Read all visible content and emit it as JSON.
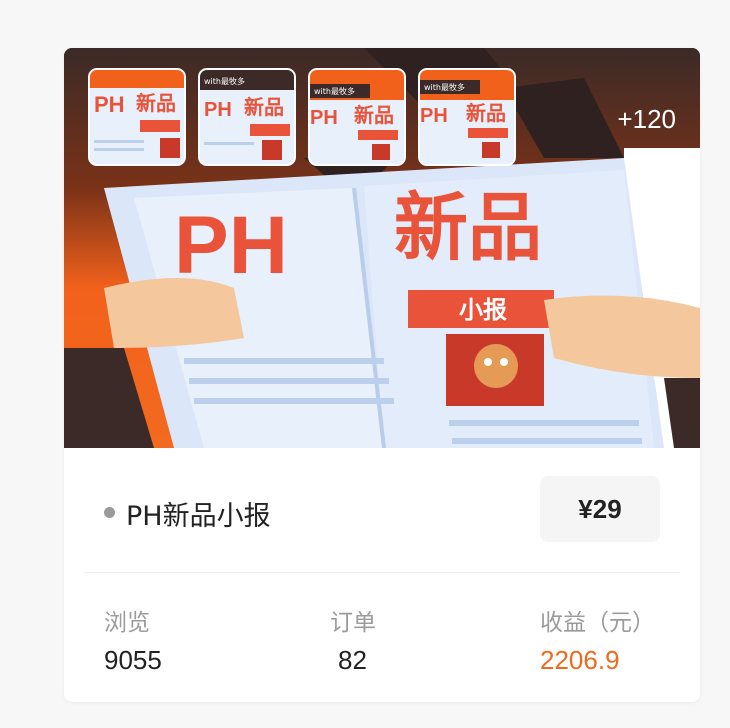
{
  "cover": {
    "banner_text_left": "PH",
    "banner_text_right": "新品",
    "banner_tag": "小报",
    "thumb_caption": "with最牧多",
    "more_count": "+120",
    "thumbnails": [
      {
        "name": "thumbnail-1"
      },
      {
        "name": "thumbnail-2"
      },
      {
        "name": "thumbnail-3"
      },
      {
        "name": "thumbnail-4"
      }
    ]
  },
  "product": {
    "title": "PH新品小报",
    "price": "¥29"
  },
  "stats": {
    "views_label": "浏览",
    "views_value": "9055",
    "orders_label": "订单",
    "orders_value": "82",
    "revenue_label": "收益（元）",
    "revenue_value": "2206.9"
  },
  "colors": {
    "accent_orange": "#f06a1d",
    "banner_red": "#e8533a",
    "paper_blue": "#dbe7f8"
  }
}
